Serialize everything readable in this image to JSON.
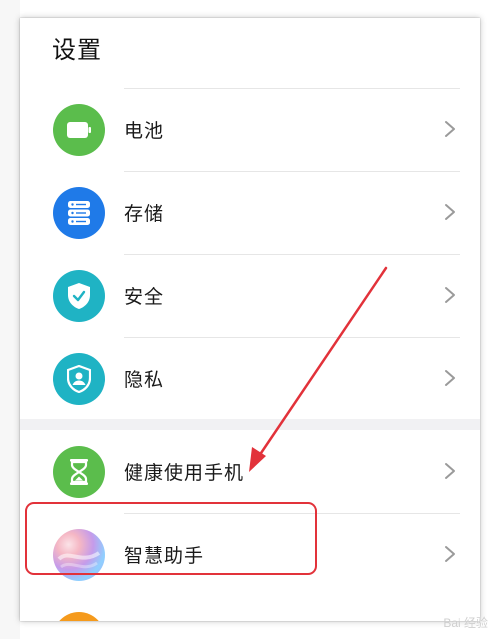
{
  "page": {
    "title": "设置"
  },
  "items": [
    {
      "label": "电池",
      "icon": "battery-icon",
      "color": "#5bbd4c"
    },
    {
      "label": "存储",
      "icon": "storage-icon",
      "color": "#1f7ae8"
    },
    {
      "label": "安全",
      "icon": "shield-check-icon",
      "color": "#1fb3c4"
    },
    {
      "label": "隐私",
      "icon": "privacy-shield-icon",
      "color": "#1fb3c4"
    },
    {
      "label": "健康使用手机",
      "icon": "hourglass-icon",
      "color": "#5bbd4c"
    },
    {
      "label": "智慧助手",
      "icon": "smart-assistant-icon",
      "color": "#b06be0"
    }
  ],
  "watermark": "Bai 经验",
  "colors": {
    "highlight": "#e2323a",
    "arrow": "#e2323a",
    "divider": "#e6e6e6"
  }
}
